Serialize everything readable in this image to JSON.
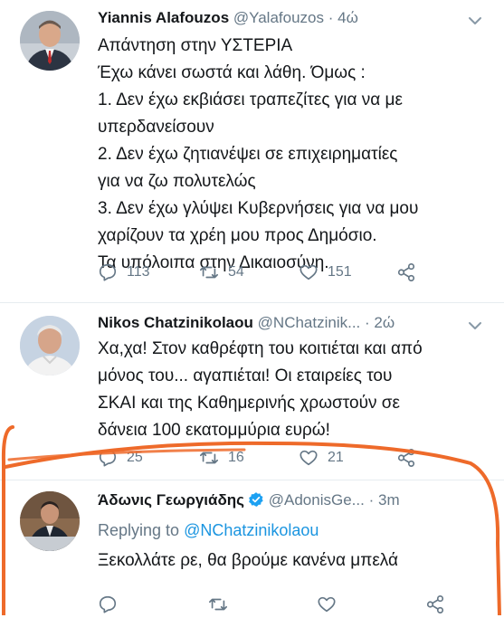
{
  "tweets": [
    {
      "name": "Yiannis Alafouzos",
      "handle": "@Yalafouzos",
      "dot": "·",
      "time": "4ώ",
      "lines": [
        "Απάντηση στην ΥΣΤΕΡΙΑ",
        "Έχω κάνει σωστά και λάθη. Όμως :",
        "1. Δεν έχω εκβιάσει τραπεζίτες για να με",
        "υπερδανείσουν",
        "2. Δεν έχω ζητιανέψει σε επιχειρηματίες",
        "για να ζω πολυτελώς",
        "3. Δεν έχω γλύψει Κυβερνήσεις  για να μου",
        "χαρίζουν τα χρέη μου προς Δημόσιο.",
        "Τα υπόλοιπα στην Δικαιοσύνη."
      ],
      "replies": "113",
      "retweets": "54",
      "likes": "151"
    },
    {
      "name": "Nikos Chatzinikolaou",
      "handle": "@NChatzinik...",
      "dot": "·",
      "time": "2ώ",
      "lines": [
        "Χα,χα! Στον καθρέφτη του κοιτιέται και από",
        "μόνος του... αγαπιέται! Οι εταιρείες του",
        "ΣΚΑΙ και της Καθημερινής χρωστούν σε",
        "δάνεια 100 εκατομμύρια ευρώ!"
      ],
      "replies": "25",
      "retweets": "16",
      "likes": "21"
    },
    {
      "name": "Άδωνις Γεωργιάδης",
      "handle": "@AdonisGe...",
      "dot": "·",
      "time": "3m",
      "replying_prefix": "Replying to ",
      "replying_to": "@NChatzinikolaou",
      "lines": [
        "Ξεκολλάτε ρε, θα βρούμε κανένα μπελά"
      ]
    }
  ],
  "colors": {
    "text": "#14171a",
    "secondary": "#657786",
    "link": "#1b95e0",
    "verified": "#1da1f2",
    "annotation": "#ee6a2a"
  }
}
